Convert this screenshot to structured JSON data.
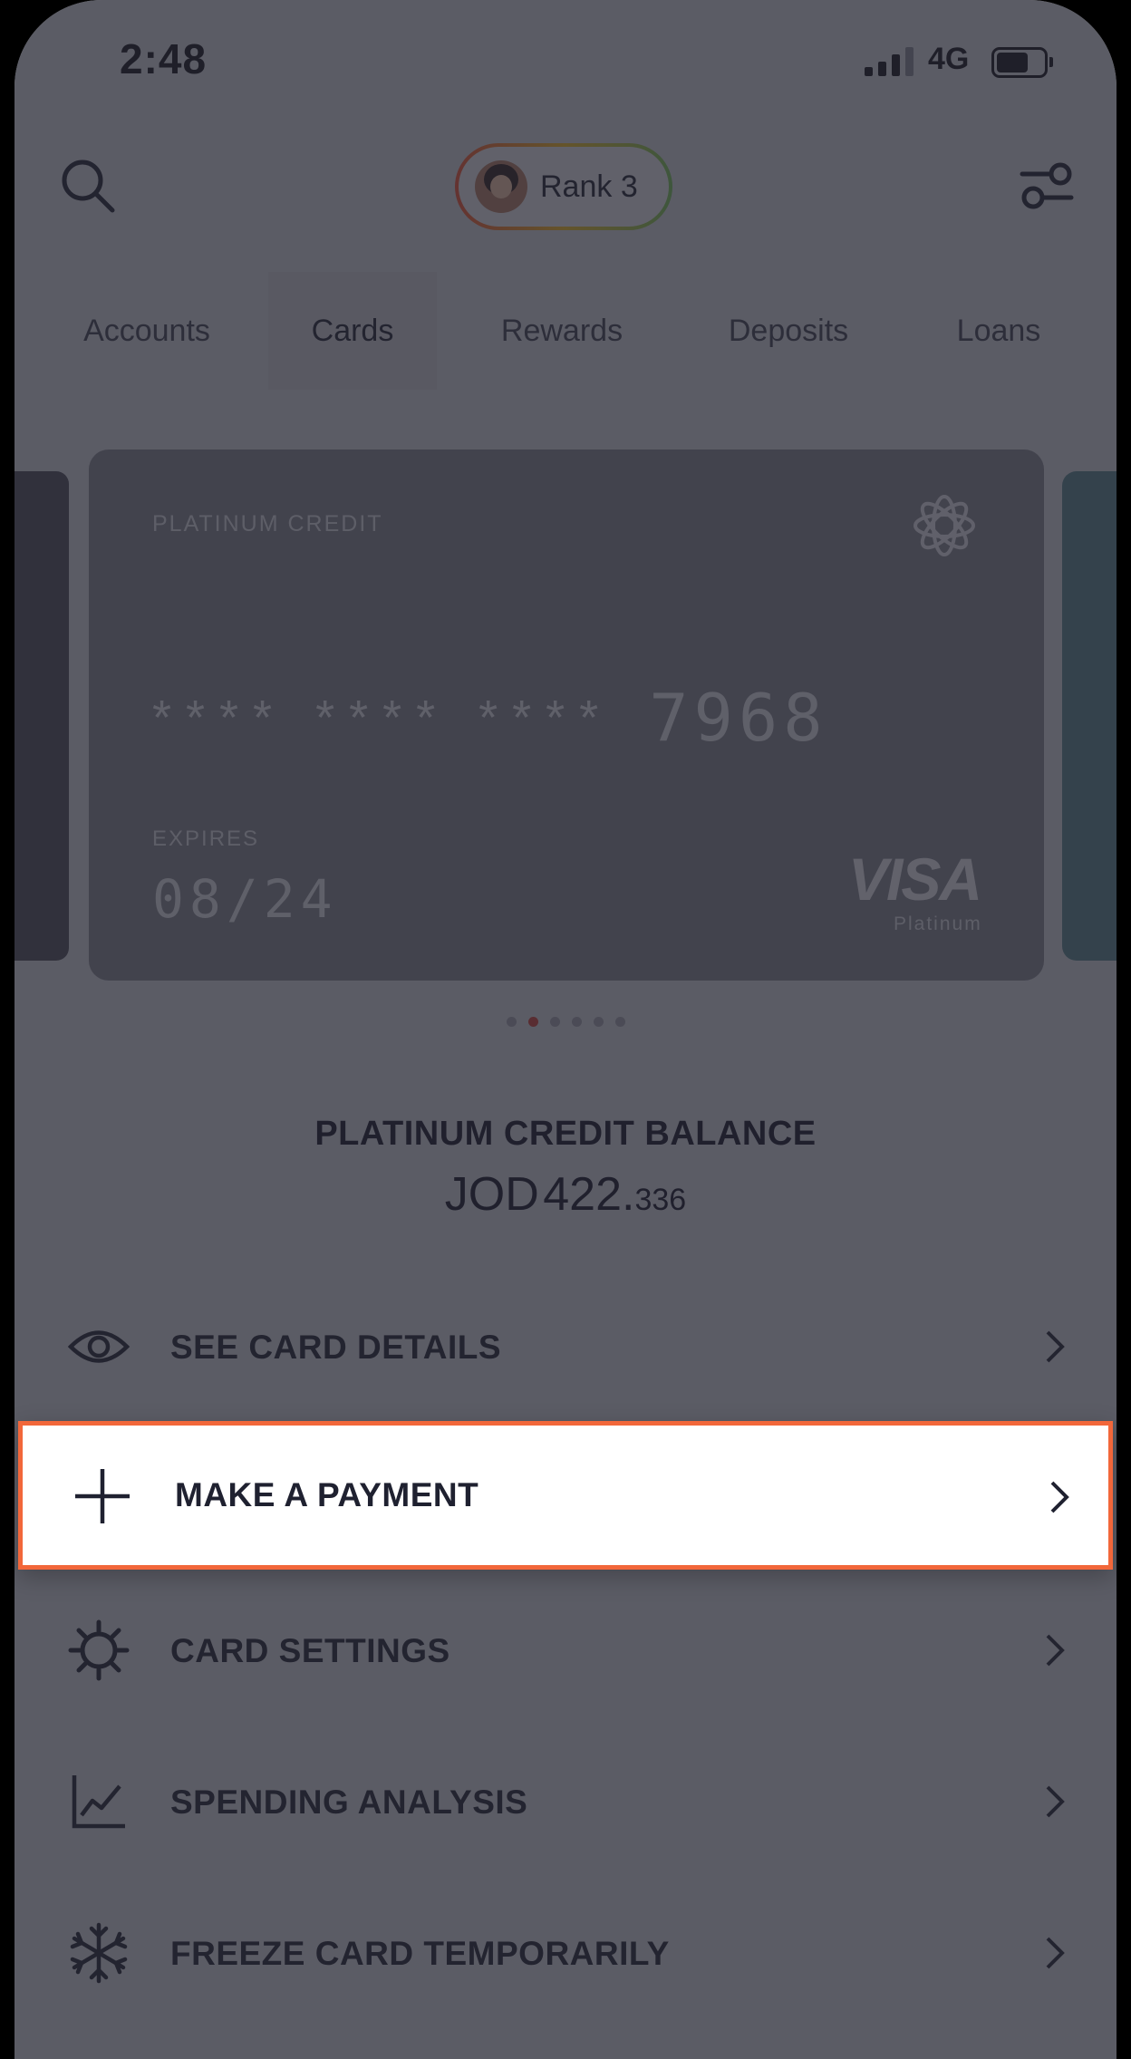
{
  "status_bar": {
    "time": "2:48",
    "network": "4G"
  },
  "header": {
    "rank_label": "Rank 3"
  },
  "tabs": [
    {
      "label": "Accounts",
      "active": false
    },
    {
      "label": "Cards",
      "active": true
    },
    {
      "label": "Rewards",
      "active": false
    },
    {
      "label": "Deposits",
      "active": false
    },
    {
      "label": "Loans",
      "active": false
    }
  ],
  "card": {
    "type": "PLATINUM CREDIT",
    "masked_groups": [
      "****",
      "****",
      "****"
    ],
    "last4": "7968",
    "expires_label": "EXPIRES",
    "expires": "08/24",
    "network_logo": "VISA",
    "network_tier": "Platinum"
  },
  "carousel": {
    "count": 6,
    "active_index": 1
  },
  "balance": {
    "title": "PLATINUM CREDIT BALANCE",
    "currency": "JOD",
    "amount_main": "422.",
    "amount_fraction": "336"
  },
  "menu": [
    {
      "label": "SEE CARD DETAILS",
      "icon": "eye-icon"
    },
    {
      "label": "MAKE A PAYMENT",
      "icon": "plus-icon",
      "highlighted": true
    },
    {
      "label": "CARD SETTINGS",
      "icon": "gear-icon"
    },
    {
      "label": "SPENDING ANALYSIS",
      "icon": "chart-icon"
    },
    {
      "label": "FREEZE CARD TEMPORARILY",
      "icon": "snowflake-icon"
    }
  ],
  "colors": {
    "highlight_border": "#f2673a",
    "overlay": "#20212c",
    "accent_dot": "#cf4a3e",
    "card": "#8a8b94",
    "next_card": "#5d8a90"
  }
}
